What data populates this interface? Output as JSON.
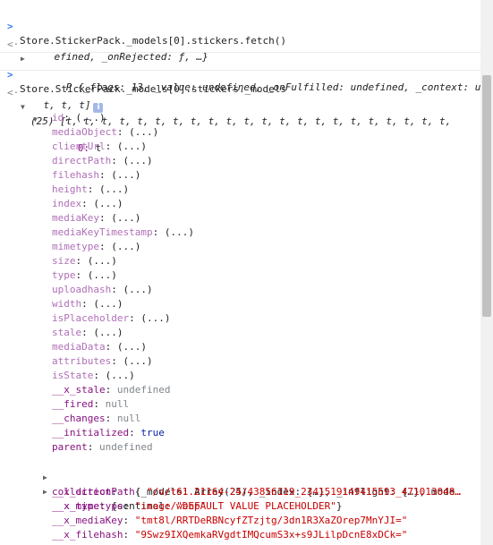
{
  "console": {
    "cmd1": "Store.StickerPack._models[0].stickers.fetch()",
    "promise_line1": "P {_flags: 13, _value: undefined, _onFulfilled: undefined, _context: und",
    "promise_line2": "efined, _onRejected: ƒ, …}",
    "cmd2": "Store.StickerPack._models[0].stickers._models",
    "array_line1": "(25) [t, t, t, t, t, t, t, t, t, t, t, t, t, t, t, t, t, t, t, t, t, t,",
    "array_line2": "t, t, t]",
    "info_glyph": "i",
    "item0_index": "0:",
    "item0_type": "t",
    "getter_placeholder": "(...)",
    "getters": [
      "id",
      "mediaObject",
      "clientUrl",
      "directPath",
      "filehash",
      "height",
      "index",
      "mediaKey",
      "mediaKeyTimestamp",
      "mimetype",
      "size",
      "type",
      "uploadhash",
      "width",
      "isPlaceholder",
      "stale",
      "mediaData",
      "attributes",
      "isState"
    ],
    "fields": [
      {
        "key": "__x_stale",
        "value": "undefined",
        "kind": "gray"
      },
      {
        "key": "__fired",
        "value": "null",
        "kind": "gray"
      },
      {
        "key": "__changes",
        "value": "null",
        "kind": "gray"
      },
      {
        "key": "__initialized",
        "value": "true",
        "kind": "kw"
      },
      {
        "key": "parent",
        "value": "undefined",
        "kind": "gray"
      }
    ],
    "collection_key": "collection",
    "collection_value": "t {_models: Array(25), _index: {…}, _inflight: {…}, mode…",
    "x_type_key": "__x_type",
    "x_type_prefix": "{sentinel: ",
    "x_type_string": "\"DEFAULT VALUE PLACEHOLDER\"",
    "x_type_suffix": "}",
    "strings": [
      {
        "key": "__x_directPath",
        "value": "\"/v/t61.21164-24/43856119_2341519149415593_471013048…"
      },
      {
        "key": "__x_mimetype",
        "value": "\"image/webp\""
      },
      {
        "key": "__x_mediaKey",
        "value": "\"tmt8l/RRTDeRBNcyfZTzjtg/3dn1R3XaZOrep7MnYJI=\""
      },
      {
        "key": "__x_filehash",
        "value": "\"9Swz9IXQemkaRVgdtIMQcumS3x+s9JLilpDcnE8xDCk=\""
      }
    ]
  }
}
